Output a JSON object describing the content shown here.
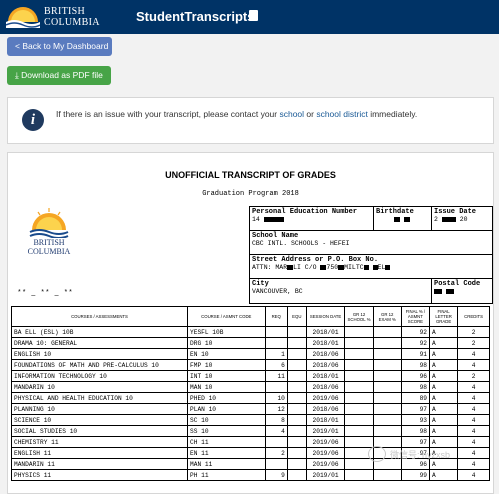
{
  "header": {
    "logo_line1": "BRITISH",
    "logo_line2": "COLUMBIA",
    "app_name": "StudentTranscripts",
    "logo_icon": "bc-sunrise-logo"
  },
  "actions": {
    "back_label": "< Back to My Dashboard",
    "pdf_label": "Download as PDF file",
    "pdf_icon": "download-icon"
  },
  "notice": {
    "icon": "info-icon",
    "text_before": "If there is an issue with your transcript, please contact your ",
    "link_school": "school",
    "text_middle": " or ",
    "link_district": "school district",
    "text_after": " immediately."
  },
  "transcript": {
    "title": "UNOFFICIAL TRANSCRIPT OF GRADES",
    "program": "Graduation Program 2018",
    "logo_line1": "BRITISH",
    "logo_line2": "COLUMBIA",
    "pen_label": "Personal Education Number",
    "pen_value": "14",
    "birthdate_label": "Birthdate",
    "issue_label": "Issue Date",
    "issue_value_start": "2",
    "issue_value_end": "20",
    "school_label": "School Name",
    "school_value": "CBC INTL. SCHOOLS - HEFEI",
    "address_label": "Street Address or P.O. Box No.",
    "address_value": "ATTN: MAR",
    "address_value_2": "LI C/O",
    "address_value_3": "750",
    "address_value_4": "MILTC",
    "address_value_5": "EL",
    "city_label": "City",
    "city_value": "VANCOUVER, BC",
    "postal_label": "Postal Code",
    "student_name": "** _ ** _ **"
  },
  "table": {
    "headers": [
      "COURSES / ASSESSMENTS",
      "COURSE / ASMNT CODE",
      "REQ",
      "EQU",
      "SESSION DATE",
      "GR 12 SCHOOL %",
      "GR 12 EXAM %",
      "FINAL % / ASMNT SCORE",
      "FINAL LETTER GRADE",
      "CREDITS"
    ],
    "rows": [
      [
        "BA ELL (ESL) 10B",
        "YESFL 10B",
        "",
        "",
        "2018/01",
        "",
        "",
        "92",
        "A",
        "2"
      ],
      [
        "DRAMA 10: GENERAL",
        "DRG 10",
        "",
        "",
        "2018/01",
        "",
        "",
        "92",
        "A",
        "2"
      ],
      [
        "ENGLISH 10",
        "EN 10",
        "1",
        "",
        "2018/06",
        "",
        "",
        "91",
        "A",
        "4"
      ],
      [
        "FOUNDATIONS OF MATH AND PRE-CALCULUS 10",
        "FMP 10",
        "6",
        "",
        "2018/06",
        "",
        "",
        "98",
        "A",
        "4"
      ],
      [
        "INFORMATION TECHNOLOGY 10",
        "INT 10",
        "11",
        "",
        "2018/01",
        "",
        "",
        "96",
        "A",
        "2"
      ],
      [
        "MANDARIN 10",
        "MAN 10",
        "",
        "",
        "2018/06",
        "",
        "",
        "98",
        "A",
        "4"
      ],
      [
        "PHYSICAL AND HEALTH EDUCATION 10",
        "PHED 10",
        "10",
        "",
        "2019/06",
        "",
        "",
        "89",
        "A",
        "4"
      ],
      [
        "PLANNING 10",
        "PLAN 10",
        "12",
        "",
        "2018/06",
        "",
        "",
        "97",
        "A",
        "4"
      ],
      [
        "SCIENCE 10",
        "SC 10",
        "8",
        "",
        "2018/01",
        "",
        "",
        "93",
        "A",
        "4"
      ],
      [
        "SOCIAL STUDIES 10",
        "SS 10",
        "4",
        "",
        "2019/01",
        "",
        "",
        "98",
        "A",
        "4"
      ],
      [
        "CHEMISTRY 11",
        "CH 11",
        "",
        "",
        "2019/06",
        "",
        "",
        "97",
        "A",
        "4"
      ],
      [
        "ENGLISH 11",
        "EN 11",
        "2",
        "",
        "2019/06",
        "",
        "",
        "97",
        "A",
        "4"
      ],
      [
        "MANDARIN 11",
        "MAN 11",
        "",
        "",
        "2019/06",
        "",
        "",
        "96",
        "A",
        "4"
      ],
      [
        "PHYSICS 11",
        "PH 11",
        "9",
        "",
        "2019/01",
        "",
        "",
        "99",
        "A",
        "4"
      ]
    ]
  },
  "watermark": {
    "text": "微信号: hyzxsb"
  },
  "colors": {
    "header_bg": "#003366",
    "back_btn": "#5a7bbf",
    "pdf_btn": "#47a447",
    "info_icon": "#1f3a5f",
    "link": "#1a5a96"
  }
}
